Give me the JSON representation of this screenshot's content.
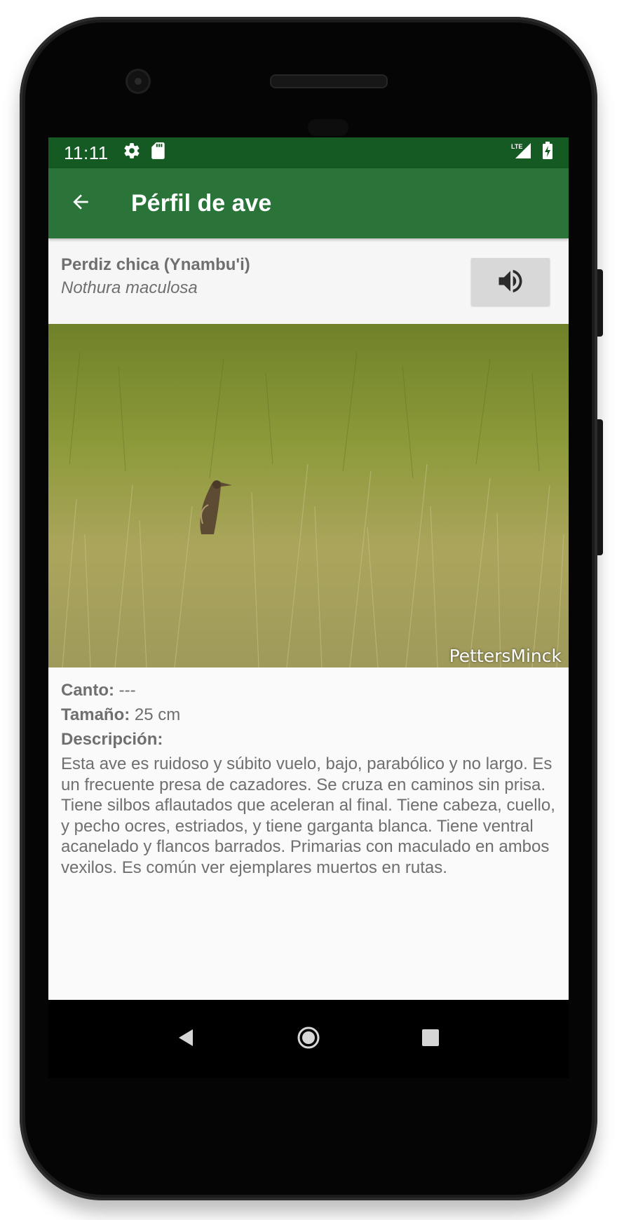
{
  "status_bar": {
    "time": "11:11",
    "icons": [
      "settings-icon",
      "sd-card-icon",
      "lte-signal-icon",
      "battery-charging-icon"
    ],
    "network_label": "LTE"
  },
  "app_bar": {
    "back_icon": "arrow-back-icon",
    "title": "Pérfil de ave"
  },
  "bird": {
    "common_name": "Perdiz chica (Ynambu'i)",
    "scientific_name": "Nothura maculosa",
    "sound_icon": "volume-up-icon"
  },
  "photo": {
    "credit": "PettersMinck"
  },
  "details": {
    "song_label": "Canto:",
    "song_value": " ---",
    "size_label": "Tamaño:",
    "size_value": " 25 cm",
    "description_label": "Descripción:",
    "description": "Esta ave es ruidoso y súbito vuelo, bajo, parabólico y no largo. Es un frecuente presa de cazadores. Se cruza en caminos sin prisa. Tiene silbos aflautados que aceleran al final. Tiene cabeza, cuello, y pecho ocres, estriados, y tiene garganta blanca. Tiene ventral acanelado y flancos barrados. Primarias con maculado en ambos vexilos. Es común ver ejemplares muertos en rutas."
  },
  "nav_bar": {
    "icons": [
      "back-triangle-icon",
      "home-circle-icon",
      "recents-square-icon"
    ]
  },
  "colors": {
    "status_bar": "#145a22",
    "app_bar": "#2a743a",
    "text": "#6f6f6f",
    "sound_button": "#d8d8d8"
  }
}
